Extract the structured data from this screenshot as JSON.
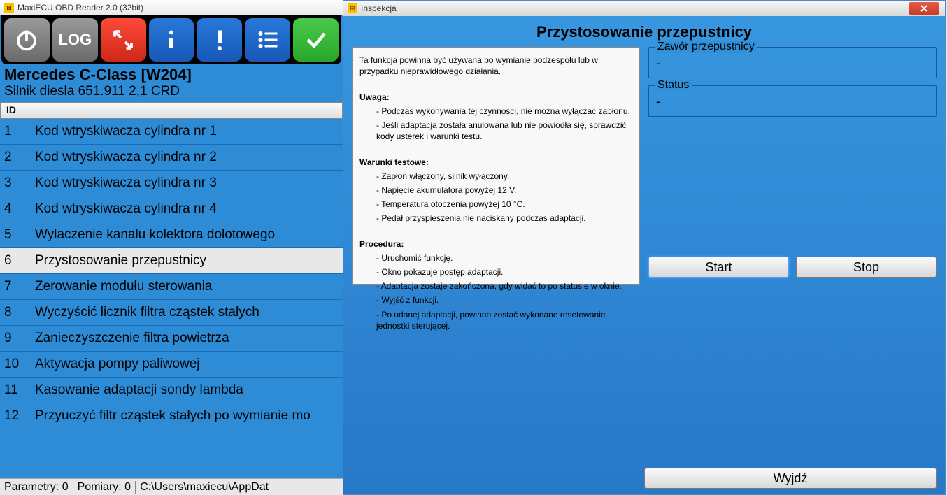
{
  "main": {
    "title": "MaxiECU OBD Reader 2.0 (32bit)",
    "vehicle": "Mercedes C-Class [W204]",
    "engine": "Silnik diesla 651.911 2,1 CRD",
    "toolbar": {
      "log": "LOG"
    },
    "table": {
      "header_id": "ID",
      "rows": [
        {
          "id": "1",
          "desc": "Kod wtryskiwacza cylindra nr 1"
        },
        {
          "id": "2",
          "desc": "Kod wtryskiwacza cylindra nr 2"
        },
        {
          "id": "3",
          "desc": "Kod wtryskiwacza cylindra nr 3"
        },
        {
          "id": "4",
          "desc": "Kod wtryskiwacza cylindra nr 4"
        },
        {
          "id": "5",
          "desc": "Wylaczenie kanalu kolektora dolotowego"
        },
        {
          "id": "6",
          "desc": "Przystosowanie przepustnicy"
        },
        {
          "id": "7",
          "desc": "Zerowanie modułu sterowania"
        },
        {
          "id": "8",
          "desc": "Wyczyścić licznik filtra cząstek stałych"
        },
        {
          "id": "9",
          "desc": "Zanieczyszczenie filtra powietrza"
        },
        {
          "id": "10",
          "desc": "Aktywacja pompy paliwowej"
        },
        {
          "id": "11",
          "desc": "Kasowanie adaptacji sondy lambda"
        },
        {
          "id": "12",
          "desc": "Przyuczyć filtr cząstek stałych po wymianie mo"
        }
      ],
      "selected": 5
    },
    "status": {
      "params": "Parametry: 0",
      "pomiary": "Pomiary: 0",
      "path": "C:\\Users\\maxiecu\\AppDat"
    }
  },
  "dialog": {
    "title": "Inspekcja",
    "heading": "Przystosowanie przepustnicy",
    "instructions": {
      "intro": "Ta funkcja powinna być używana po wymianie podzespołu lub w przypadku nieprawidłowego działania.",
      "uwaga_h": "Uwaga:",
      "uwaga_1": "- Podczas wykonywania tej czynności, nie można wyłączać zapłonu.",
      "uwaga_2": "- Jeśli adaptacja została anulowana lub nie powiodła się, sprawdzić kody usterek i warunki testu.",
      "warunki_h": "Warunki testowe:",
      "warunki_1": "- Zapłon włączony, silnik wyłączony.",
      "warunki_2": "- Napięcie akumulatora powyżej 12 V.",
      "warunki_3": "- Temperatura otoczenia powyżej 10 °C.",
      "warunki_4": "- Pedał przyspieszenia nie naciskany podczas adaptacji.",
      "proc_h": "Procedura:",
      "proc_1": "- Uruchomić funkcję.",
      "proc_2": "- Okno pokazuje postęp adaptacji.",
      "proc_3": "- Adaptacja zostaje zakończona, gdy widać to po statusie w oknie.",
      "proc_4": "- Wyjść z funkcji.",
      "proc_5": "- Po udanej adaptacji, powinno zostać wykonane resetowanie jednostki sterującej."
    },
    "fields": {
      "valve_label": "Zawór przepustnicy",
      "valve_value": "-",
      "status_label": "Status",
      "status_value": "-"
    },
    "buttons": {
      "start": "Start",
      "stop": "Stop",
      "exit": "Wyjdź"
    }
  }
}
